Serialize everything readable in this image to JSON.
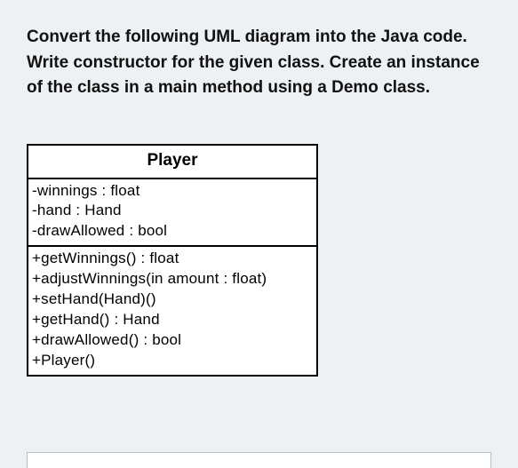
{
  "prompt": "Convert the following UML diagram into the Java code. Write constructor for the given class. Create an instance of the class in a main method using a Demo class.",
  "uml": {
    "class_name": "Player",
    "attributes": [
      "-winnings : float",
      "-hand : Hand",
      "-drawAllowed : bool"
    ],
    "methods": [
      "+getWinnings() : float",
      "+adjustWinnings(in amount : float)",
      "+setHand(Hand)()",
      "+getHand() : Hand",
      "+drawAllowed() : bool",
      "+Player()"
    ]
  }
}
